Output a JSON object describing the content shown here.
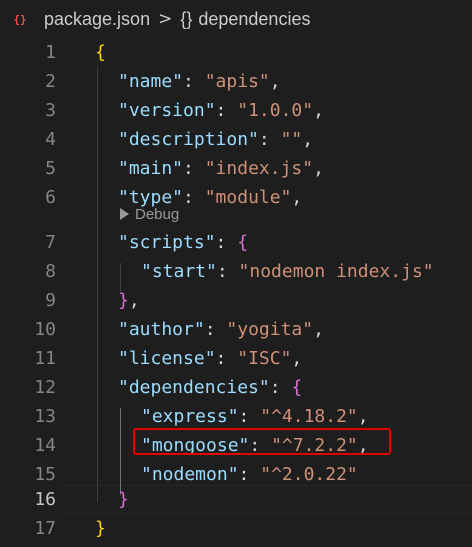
{
  "breadcrumb": {
    "file_icon": "{}",
    "file": "package.json",
    "separator": ">",
    "symbol_icon": "{}",
    "symbol": "dependencies"
  },
  "codelens": {
    "label": "Debug"
  },
  "gutter": {
    "line_numbers": [
      "1",
      "2",
      "3",
      "4",
      "5",
      "6",
      "7",
      "8",
      "9",
      "10",
      "11",
      "12",
      "13",
      "14",
      "15",
      "16",
      "17"
    ]
  },
  "code": {
    "l1": {
      "open": "{"
    },
    "l2": {
      "key": "\"name\"",
      "colon": ": ",
      "val": "\"apis\"",
      "comma": ","
    },
    "l3": {
      "key": "\"version\"",
      "colon": ": ",
      "val": "\"1.0.0\"",
      "comma": ","
    },
    "l4": {
      "key": "\"description\"",
      "colon": ": ",
      "val": "\"\"",
      "comma": ","
    },
    "l5": {
      "key": "\"main\"",
      "colon": ": ",
      "val": "\"index.js\"",
      "comma": ","
    },
    "l6": {
      "key": "\"type\"",
      "colon": ": ",
      "val": "\"module\"",
      "comma": ","
    },
    "l7": {
      "key": "\"scripts\"",
      "colon": ": ",
      "open": "{"
    },
    "l8": {
      "key": "\"start\"",
      "colon": ": ",
      "val": "\"nodemon index.js\""
    },
    "l9": {
      "close": "}",
      "comma": ","
    },
    "l10": {
      "key": "\"author\"",
      "colon": ": ",
      "val": "\"yogita\"",
      "comma": ","
    },
    "l11": {
      "key": "\"license\"",
      "colon": ": ",
      "val": "\"ISC\"",
      "comma": ","
    },
    "l12": {
      "key": "\"dependencies\"",
      "colon": ": ",
      "open": "{"
    },
    "l13": {
      "key": "\"express\"",
      "colon": ": ",
      "val": "\"^4.18.2\"",
      "comma": ","
    },
    "l14": {
      "key": "\"mongoose\"",
      "colon": ": ",
      "val": "\"^7.2.2\"",
      "comma": ","
    },
    "l15": {
      "key": "\"nodemon\"",
      "colon": ": ",
      "val": "\"^2.0.22\""
    },
    "l16": {
      "close": "}"
    },
    "l17": {
      "close": "}"
    }
  },
  "colors": {
    "background": "#1e1e1e",
    "key": "#9cdcfe",
    "string": "#ce9178",
    "bracket_level1": "#ffd700",
    "bracket_level2": "#da70d6",
    "annotation_box": "#e00000"
  }
}
